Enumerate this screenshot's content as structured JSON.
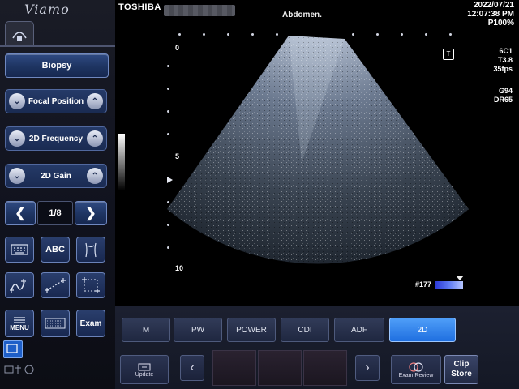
{
  "header": {
    "logo": "Viamo",
    "brand": "TOSHIBA",
    "exam_preset": "Abdomen.",
    "date": "2022/07/21",
    "time": "12:07:38 PM",
    "power": "P100%"
  },
  "image_params": {
    "probe": "6C1",
    "t": "T3.8",
    "fps": "35fps",
    "gain": "G94",
    "dr": "DR65",
    "frame_counter": "#177"
  },
  "depth_scale": {
    "labels": [
      "0",
      "5",
      "10"
    ]
  },
  "left_panel": {
    "biopsy_label": "Biopsy",
    "controls": [
      {
        "label": "Focal Position"
      },
      {
        "label": "2D Frequency"
      },
      {
        "label": "2D Gain"
      }
    ],
    "page_indicator": "1/8",
    "tool_buttons": {
      "abc_label": "ABC"
    },
    "menu_label": "MENU",
    "exam_label": "Exam"
  },
  "modes": [
    {
      "label": "M",
      "active": false
    },
    {
      "label": "PW",
      "active": false
    },
    {
      "label": "POWER",
      "active": false
    },
    {
      "label": "CDI",
      "active": false
    },
    {
      "label": "ADF",
      "active": false
    },
    {
      "label": "2D",
      "active": true
    }
  ],
  "clip_bar": {
    "update_label": "Update",
    "review_label": "Exam Review",
    "clip_store_line1": "Clip",
    "clip_store_line2": "Store"
  },
  "colors": {
    "accent_blue": "#1f6fe0",
    "panel_button": "#1e3461"
  },
  "icons": [
    "probe-icon",
    "chevron-up-icon",
    "chevron-down-icon",
    "arrow-left-icon",
    "arrow-right-icon",
    "keyboard-icon",
    "body-mark-icon",
    "trace-icon",
    "distance-icon",
    "ellipse-icon"
  ]
}
